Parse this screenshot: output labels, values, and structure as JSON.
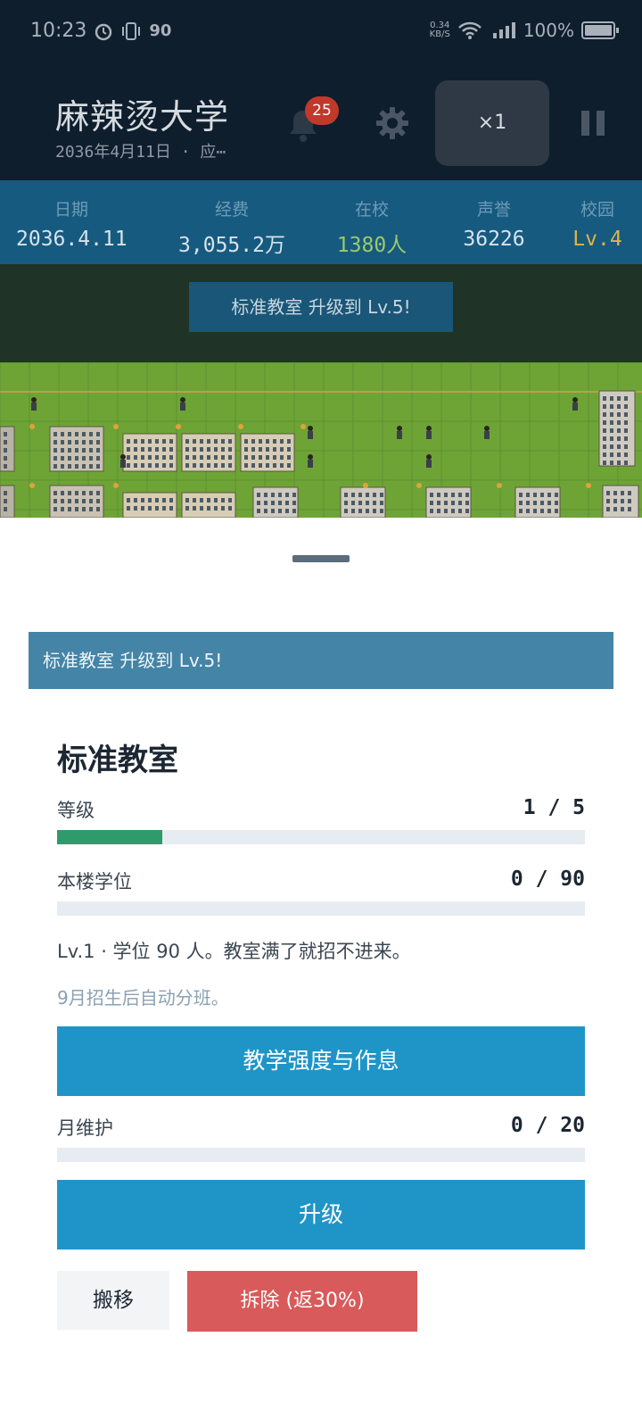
{
  "status_bar": {
    "time": "10:23",
    "net_speed_top": "0.34",
    "net_speed_unit": "KB/S",
    "battery": "100%"
  },
  "header": {
    "university_name": "麻辣烫大学",
    "date_line": "2036年4月11日 · 应⋯",
    "notification_count": "25",
    "speed_label": "×1"
  },
  "stats": [
    {
      "label": "日期",
      "value": "2036.4.11",
      "color": "#d7e2ea"
    },
    {
      "label": "经费",
      "value": "3,055.2万",
      "color": "#d7e2ea"
    },
    {
      "label": "在校",
      "value": "1380人",
      "color": "#9cc96b"
    },
    {
      "label": "声誉",
      "value": "36226",
      "color": "#d7e2ea"
    },
    {
      "label": "校园",
      "value": "Lv.4",
      "color": "#e0b34a"
    }
  ],
  "toast": {
    "text": "标准教室 升级到 Lv.5!"
  },
  "panel": {
    "banner": "标准教室 升级到 Lv.5!",
    "title": "标准教室",
    "level_label": "等级",
    "level_value": "1 / 5",
    "level_progress": 0.2,
    "seats_label": "本楼学位",
    "seats_value": "0 / 90",
    "seats_progress": 0,
    "description": "Lv.1 · 学位 90 人。教室满了就招不进来。",
    "note": "9月招生后自动分班。",
    "teaching_button": "教学强度与作息",
    "maintenance_label": "月维护",
    "maintenance_value": "0 / 20",
    "maintenance_progress": 0,
    "upgrade_button": "升级",
    "move_button": "搬移",
    "demolish_button": "拆除 (返30%)"
  },
  "colors": {
    "header_bg": "#0f1e2d",
    "stats_bg": "#165a80",
    "accent_blue": "#1f95c7",
    "progress_green": "#2f9b6c",
    "danger_red": "#d95a5a"
  }
}
